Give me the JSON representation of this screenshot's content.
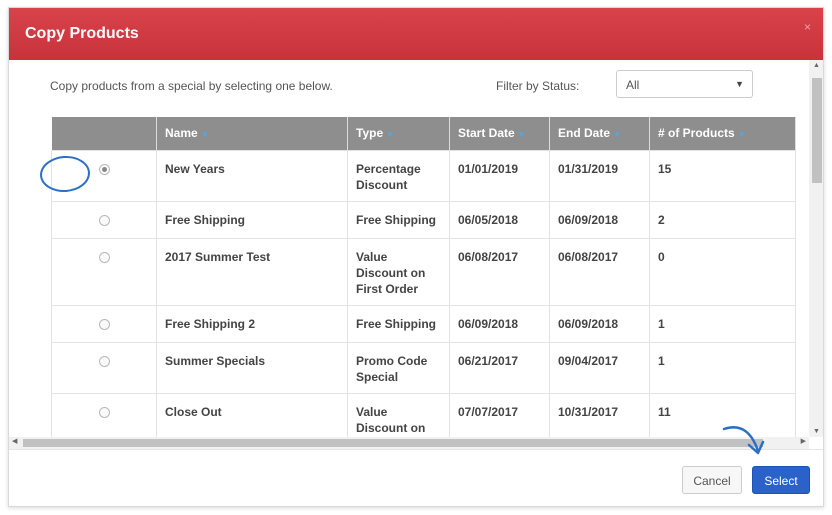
{
  "modal": {
    "title": "Copy Products",
    "close_glyph": "×"
  },
  "intro_text": "Copy products from a special by selecting one below.",
  "filter": {
    "label": "Filter by Status:",
    "value": "All"
  },
  "table": {
    "headers": [
      "Name",
      "Type",
      "Start Date",
      "End Date",
      "# of Products"
    ],
    "rows": [
      {
        "name": "New Years",
        "type": "Percentage Discount",
        "start": "01/01/2019",
        "end": "01/31/2019",
        "count": "15",
        "selected": true
      },
      {
        "name": "Free Shipping",
        "type": "Free Shipping",
        "start": "06/05/2018",
        "end": "06/09/2018",
        "count": "2",
        "selected": false
      },
      {
        "name": "2017 Summer Test",
        "type": "Value Discount on First Order",
        "start": "06/08/2017",
        "end": "06/08/2017",
        "count": "0",
        "selected": false
      },
      {
        "name": "Free Shipping 2",
        "type": "Free Shipping",
        "start": "06/09/2018",
        "end": "06/09/2018",
        "count": "1",
        "selected": false
      },
      {
        "name": "Summer Specials",
        "type": "Promo Code Special",
        "start": "06/21/2017",
        "end": "09/04/2017",
        "count": "1",
        "selected": false
      },
      {
        "name": "Close Out",
        "type": "Value Discount on",
        "start": "07/07/2017",
        "end": "10/31/2017",
        "count": "11",
        "selected": false
      }
    ]
  },
  "footer": {
    "cancel_label": "Cancel",
    "select_label": "Select"
  },
  "colors": {
    "header_red": "#d13b43",
    "primary_blue": "#2a62c9",
    "annotation_blue": "#2d6fc4"
  }
}
